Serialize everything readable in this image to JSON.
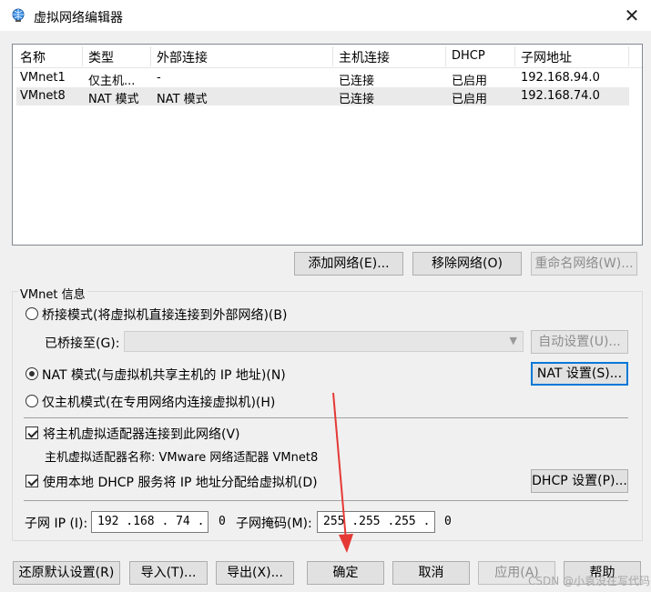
{
  "window": {
    "title": "虚拟网络编辑器",
    "close_glyph": "✕"
  },
  "table": {
    "headers": [
      "名称",
      "类型",
      "外部连接",
      "主机连接",
      "DHCP",
      "子网地址"
    ],
    "rows": [
      [
        "VMnet1",
        "仅主机...",
        "-",
        "已连接",
        "已启用",
        "192.168.94.0"
      ],
      [
        "VMnet8",
        "NAT 模式",
        "NAT 模式",
        "已连接",
        "已启用",
        "192.168.74.0"
      ]
    ]
  },
  "network_buttons": {
    "add": "添加网络(E)...",
    "remove": "移除网络(O)",
    "rename": "重命名网络(W)..."
  },
  "vmnet_info": {
    "group_title": "VMnet 信息",
    "bridged_label": "桥接模式(将虚拟机直接连接到外部网络)(B)",
    "bridged_to_label": "已桥接至(G):",
    "bridged_to_value": "",
    "auto_settings": "自动设置(U)...",
    "nat_label": "NAT 模式(与虚拟机共享主机的 IP 地址)(N)",
    "nat_settings": "NAT 设置(S)...",
    "hostonly_label": "仅主机模式(在专用网络内连接虚拟机)(H)",
    "connect_adapter_label": "将主机虚拟适配器连接到此网络(V)",
    "adapter_name_label": "主机虚拟适配器名称: VMware 网络适配器 VMnet8",
    "dhcp_label": "使用本地 DHCP 服务将 IP 地址分配给虚拟机(D)",
    "dhcp_settings": "DHCP 设置(P)...",
    "subnet_ip_label": "子网 IP (I):",
    "subnet_ip_value": "192 .168 . 74 .  0",
    "subnet_mask_label": "子网掩码(M):",
    "subnet_mask_value": "255 .255 .255 .  0"
  },
  "selection": {
    "mode": "nat",
    "connect_adapter": true,
    "dhcp": true
  },
  "footer": {
    "restore": "还原默认设置(R)",
    "import": "导入(T)...",
    "export": "导出(X)...",
    "ok": "确定",
    "cancel": "取消",
    "apply": "应用(A)",
    "help": "帮助"
  },
  "watermark": "CSDN @小袁没在写代码",
  "colors": {
    "accent": "#0078d7",
    "annotation_arrow": "#e53935"
  }
}
